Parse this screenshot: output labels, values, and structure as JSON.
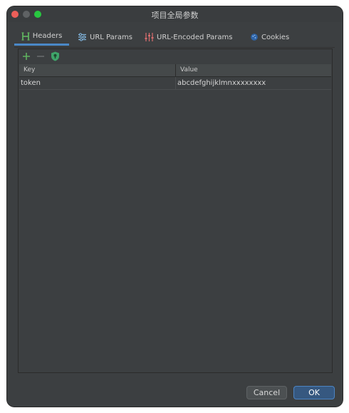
{
  "window": {
    "title": "项目全局参数"
  },
  "tabs": [
    {
      "label": "Headers",
      "icon": "h-icon",
      "active": true
    },
    {
      "label": "URL Params",
      "icon": "sliders-icon",
      "active": false
    },
    {
      "label": "URL-Encoded Params",
      "icon": "equalizer-icon",
      "active": false
    },
    {
      "label": "Cookies",
      "icon": "cookie-icon",
      "active": false
    }
  ],
  "toolbar": {
    "add": "+",
    "remove": "−"
  },
  "table": {
    "columns": [
      "Key",
      "Value"
    ],
    "rows": [
      {
        "key": "token",
        "value": "abcdefghijklmnxxxxxxxx"
      }
    ]
  },
  "buttons": {
    "cancel": "Cancel",
    "ok": "OK"
  },
  "colors": {
    "accent": "#4a88c7",
    "green": "#5fb15f",
    "background": "#3c3f41"
  }
}
